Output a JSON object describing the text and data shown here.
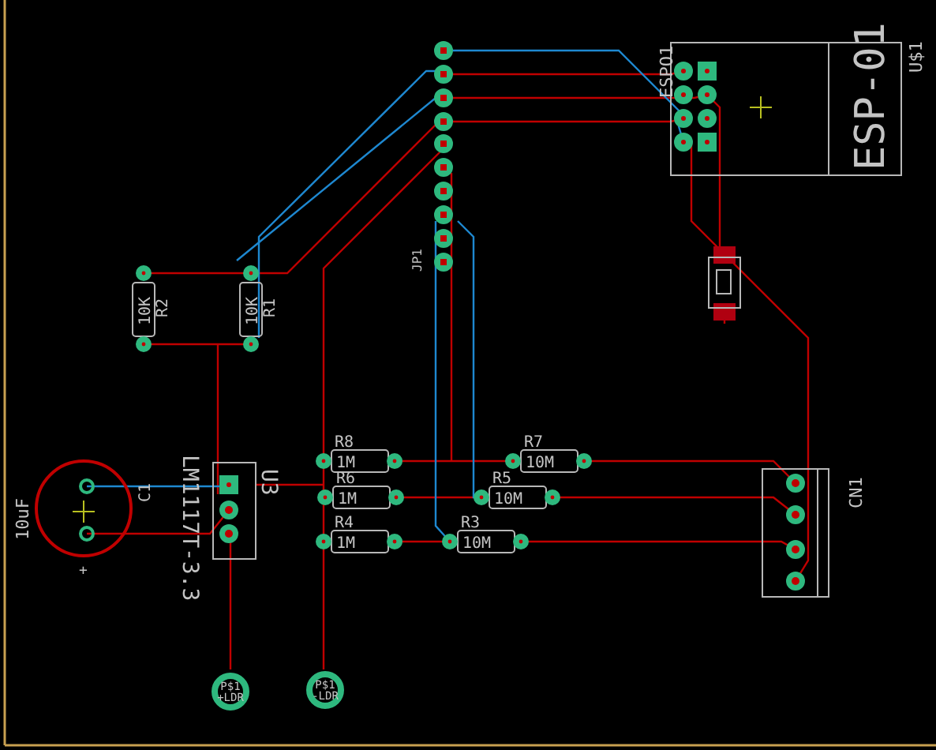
{
  "esp_module": {
    "name": "ESPO1",
    "value": "ESP-01",
    "tag": "U$1"
  },
  "header": {
    "name": "JP1"
  },
  "resistors": [
    {
      "name": "R2",
      "value": "10K"
    },
    {
      "name": "R1",
      "value": "10K"
    },
    {
      "name": "R8",
      "value": "1M"
    },
    {
      "name": "R6",
      "value": "1M"
    },
    {
      "name": "R4",
      "value": "1M"
    },
    {
      "name": "R7",
      "value": "10M"
    },
    {
      "name": "R5",
      "value": "10M"
    },
    {
      "name": "R3",
      "value": "10M"
    }
  ],
  "capacitor": {
    "name": "C1",
    "value": "10uF",
    "polarity": "+"
  },
  "regulator": {
    "name": "U3",
    "value": "LM1117T-3.3"
  },
  "connector": {
    "name": "CN1"
  },
  "pads": [
    {
      "name": "P$1",
      "signal": "+LDR"
    },
    {
      "name": "P$1",
      "signal": "-LDR"
    }
  ]
}
